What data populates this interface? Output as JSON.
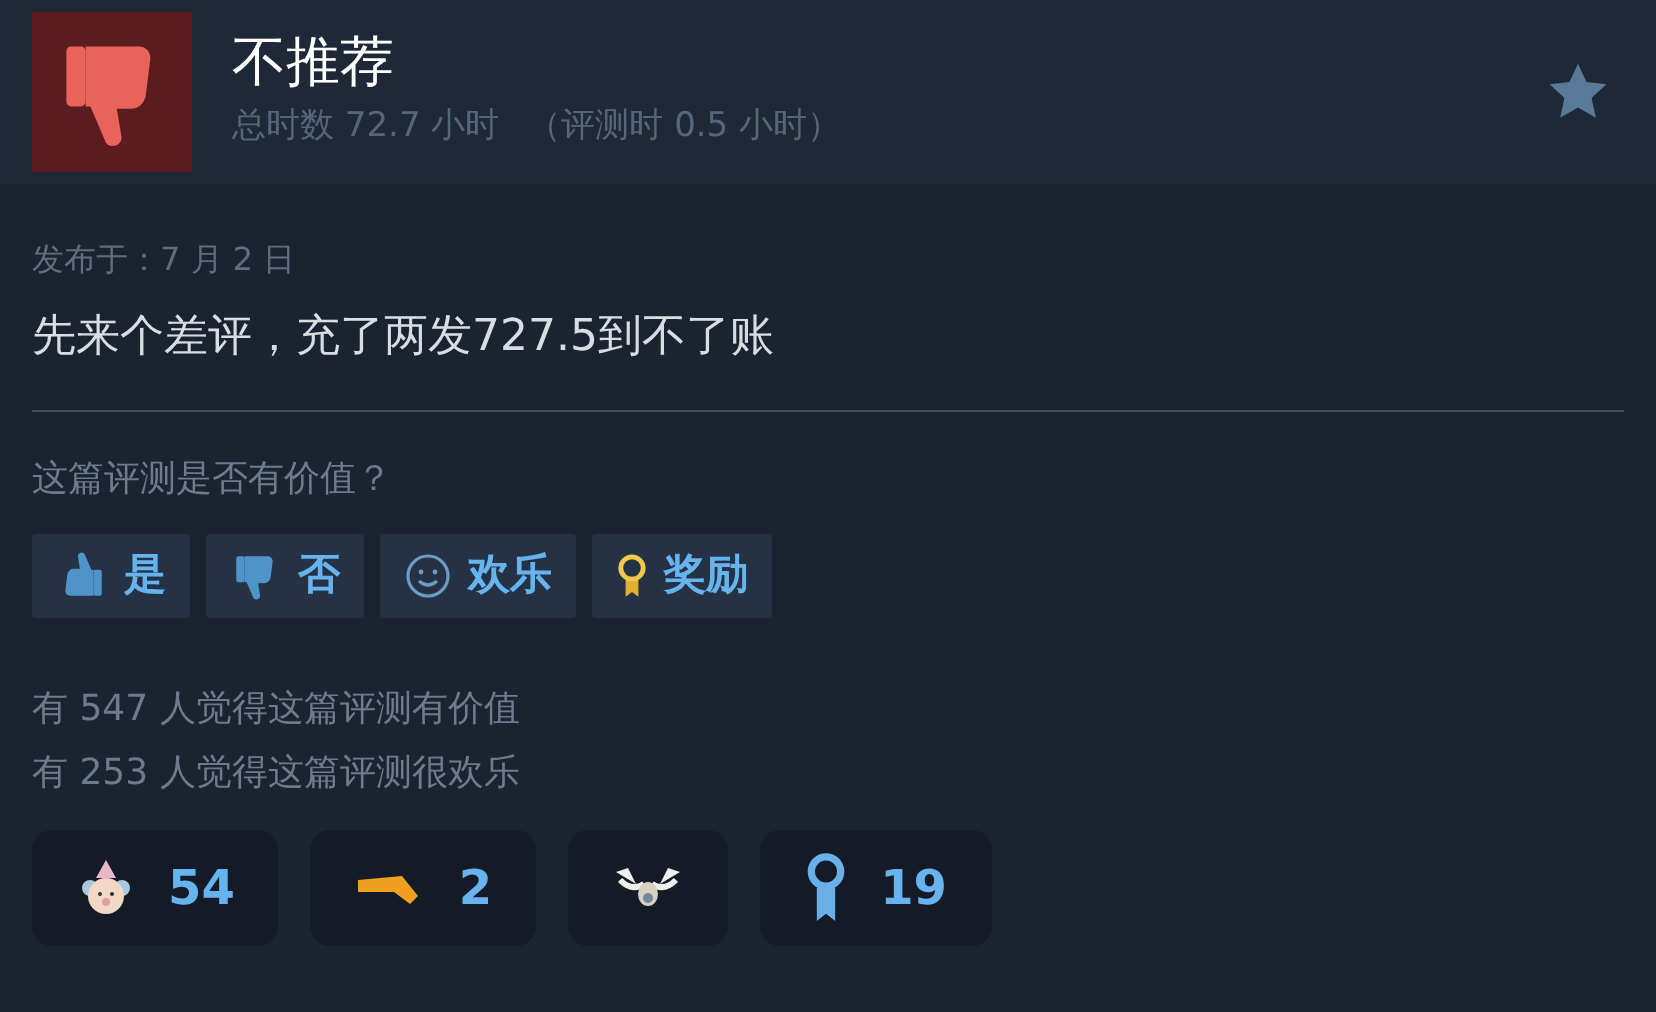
{
  "review": {
    "recommended": false,
    "verdict": "不推荐",
    "hours": "总时数 72.7 小时",
    "hours_at_review": "（评测时 0.5 小时）",
    "posted": "发布于：7 月 2 日",
    "text": "先来个差评，充了两发727.5到不了账"
  },
  "helpful_prompt": "这篇评测是否有价值？",
  "vote_buttons": [
    {
      "kind": "up",
      "label": "是"
    },
    {
      "kind": "down",
      "label": "否"
    },
    {
      "kind": "smile",
      "label": "欢乐"
    },
    {
      "kind": "award",
      "label": "奖励"
    }
  ],
  "stats": [
    "有 547 人觉得这篇评测有价值",
    "有 253 人觉得这篇评测很欢乐"
  ],
  "awards": [
    {
      "kind": "clown",
      "count": "54"
    },
    {
      "kind": "horn",
      "count": "2"
    },
    {
      "kind": "reindeer"
    },
    {
      "kind": "ribbon",
      "count": "19"
    }
  ]
}
